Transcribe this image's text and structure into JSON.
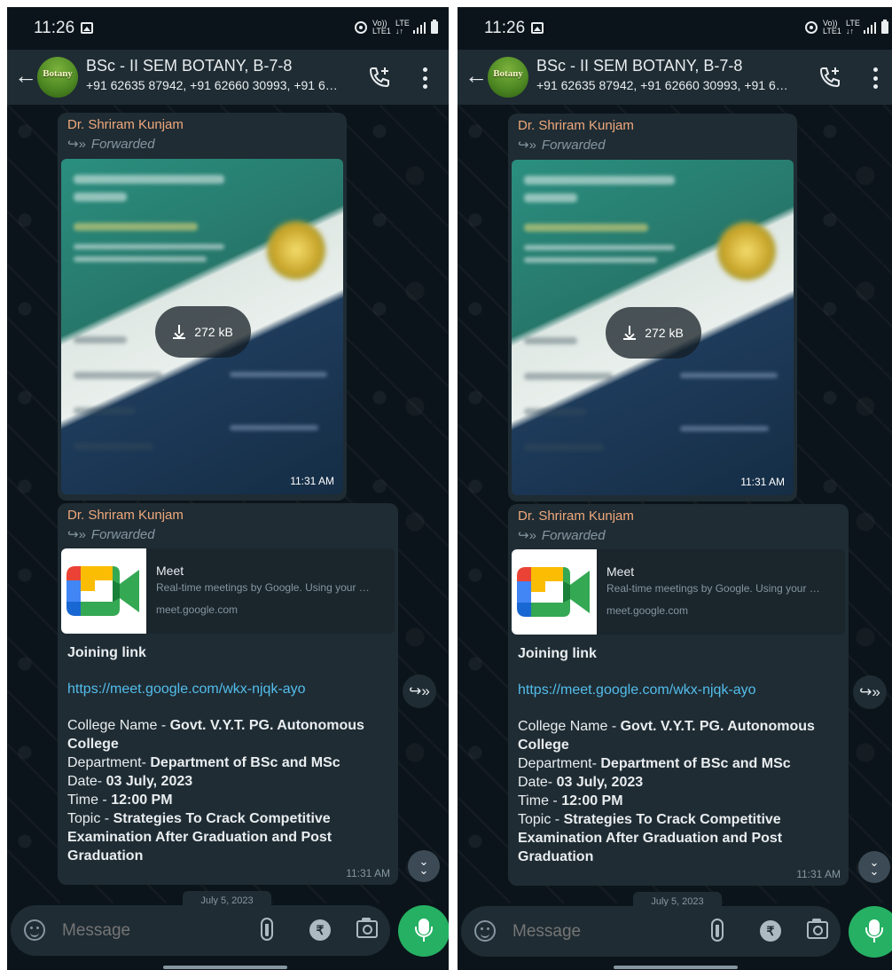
{
  "status_bar": {
    "time": "11:26",
    "lte_top": "Vo))",
    "lte_bottom": "LTE1",
    "lte2_top": "LTE",
    "lte2_bottom": "↓↑"
  },
  "header": {
    "avatar_text": "Botany",
    "title": "BSc - II SEM BOTANY, B-7-8",
    "participants": "+91 62635 87942, +91 62660 30993, +91 6…"
  },
  "messages": [
    {
      "sender": "Dr. Shriram Kunjam",
      "forwarded_label": "Forwarded",
      "attachment_size": "272 kB",
      "time": "11:31 AM"
    },
    {
      "sender": "Dr. Shriram Kunjam",
      "forwarded_label": "Forwarded",
      "preview": {
        "title": "Meet",
        "description": "Real-time meetings by Google. Using your …",
        "domain": "meet.google.com"
      },
      "joining_label": "Joining link",
      "link": "https://meet.google.com/wkx-njqk-ayo",
      "college_label": "College Name - ",
      "college_value": "Govt. V.Y.T. PG. Autonomous College",
      "department_label": "Department- ",
      "department_value": "Department of  BSc and MSc",
      "date_label": "Date- ",
      "date_value": "03 July, 2023",
      "time_label": "Time - ",
      "time_value": "12:00 PM",
      "topic_label": "Topic - ",
      "topic_value": "Strategies To Crack Competitive Examination After Graduation and Post Graduation",
      "time": "11:31 AM"
    }
  ],
  "date_chip": "July 5, 2023",
  "composer": {
    "placeholder": "Message",
    "rupee_symbol": "₹"
  },
  "colors": {
    "background": "#0b141a",
    "header": "#1f2c34",
    "bubble": "#1f2c34",
    "sender": "#f0a97b",
    "link": "#53bdeb",
    "mic_button": "#25b063"
  },
  "icons": [
    "back-arrow-icon",
    "add-call-icon",
    "more-vert-icon",
    "forwarded-icon",
    "download-icon",
    "share-icon",
    "scroll-down-icon",
    "emoji-icon",
    "attach-icon",
    "rupee-icon",
    "camera-icon",
    "mic-icon"
  ]
}
